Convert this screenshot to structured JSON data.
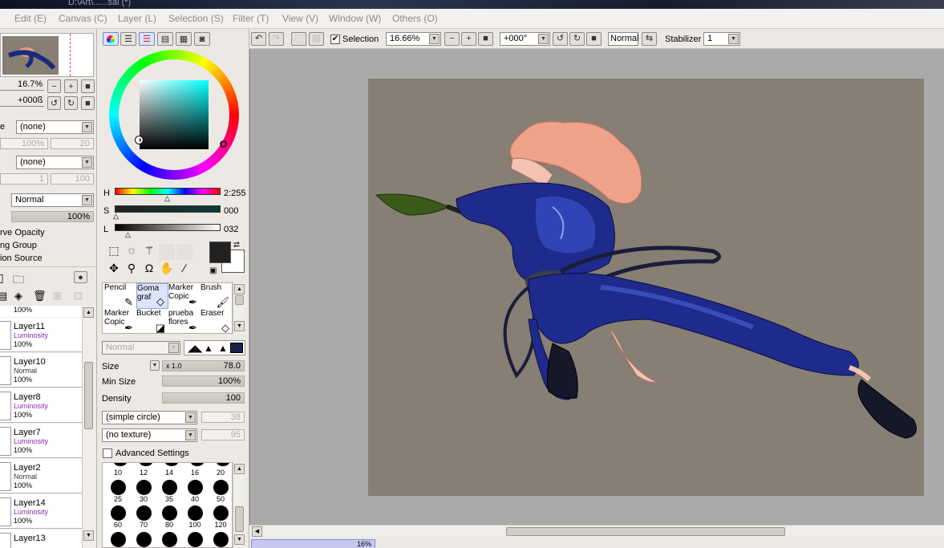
{
  "window": {
    "title": "D:\\Art\\......sai (*)"
  },
  "menu": [
    "Edit (E)",
    "Canvas (C)",
    "Layer (L)",
    "Selection (S)",
    "Filter (T)",
    "View (V)",
    "Window (W)",
    "Others (O)"
  ],
  "navigator": {
    "zoom": "16.7%",
    "angle": "+000ß"
  },
  "layer_props": {
    "paper_texture": "(none)",
    "paper_opacity": "100%",
    "paper_strength": "20",
    "effect": "(none)",
    "effect_width": "1",
    "effect_strength": "100",
    "blend_mode": "Normal",
    "opacity": "100%",
    "preserve_opacity": "rve Opacity",
    "clipping_group": "ng Group",
    "selection_source": "ion Source"
  },
  "layers": {
    "top_op": "100%",
    "items": [
      {
        "name": "Layer11",
        "mode": "Luminosity",
        "opacity": "100%"
      },
      {
        "name": "Layer10",
        "mode": "Normal",
        "opacity": "100%"
      },
      {
        "name": "Layer8",
        "mode": "Luminosity",
        "opacity": "100%"
      },
      {
        "name": "Layer7",
        "mode": "Luminosity",
        "opacity": "100%"
      },
      {
        "name": "Layer2",
        "mode": "Normal",
        "opacity": "100%"
      },
      {
        "name": "Layer14",
        "mode": "Luminosity",
        "opacity": "100%"
      },
      {
        "name": "Layer13",
        "mode": "",
        "opacity": ""
      }
    ]
  },
  "color": {
    "h_label": "H",
    "h_value": "2:255",
    "s_label": "S",
    "s_value": "000",
    "l_label": "L",
    "l_value": "032",
    "primary": "#222222",
    "secondary": "#ffffff"
  },
  "tools": [
    {
      "name": "Pencil",
      "line2": ""
    },
    {
      "name": "Goma",
      "line2": "graf"
    },
    {
      "name": "Marker",
      "line2": "Copic"
    },
    {
      "name": "Brush",
      "line2": ""
    },
    {
      "name": "Marker",
      "line2": "Copic"
    },
    {
      "name": "Bucket",
      "line2": ""
    },
    {
      "name": "prueba",
      "line2": "flores"
    },
    {
      "name": "Eraser",
      "line2": ""
    }
  ],
  "brush": {
    "blend": "Normal",
    "size_label": "Size",
    "size_mult": "x 1.0",
    "size_value": "78.0",
    "min_size_label": "Min Size",
    "min_size_value": "100%",
    "density_label": "Density",
    "density_value": "100",
    "shape": "(simple circle)",
    "shape_value": "38",
    "texture": "(no texture)",
    "texture_value": "95",
    "advanced": "Advanced Settings",
    "sizes": [
      "10",
      "12",
      "14",
      "16",
      "20",
      "25",
      "30",
      "35",
      "40",
      "50",
      "60",
      "70",
      "80",
      "100",
      "120"
    ]
  },
  "toolbar": {
    "selection_label": "Selection",
    "zoom": "16.66%",
    "angle": "+000°",
    "blend": "Normal",
    "stabilizer_label": "Stabilizer",
    "stabilizer_value": "1"
  },
  "doc_tab": {
    "zoom": "16%"
  }
}
